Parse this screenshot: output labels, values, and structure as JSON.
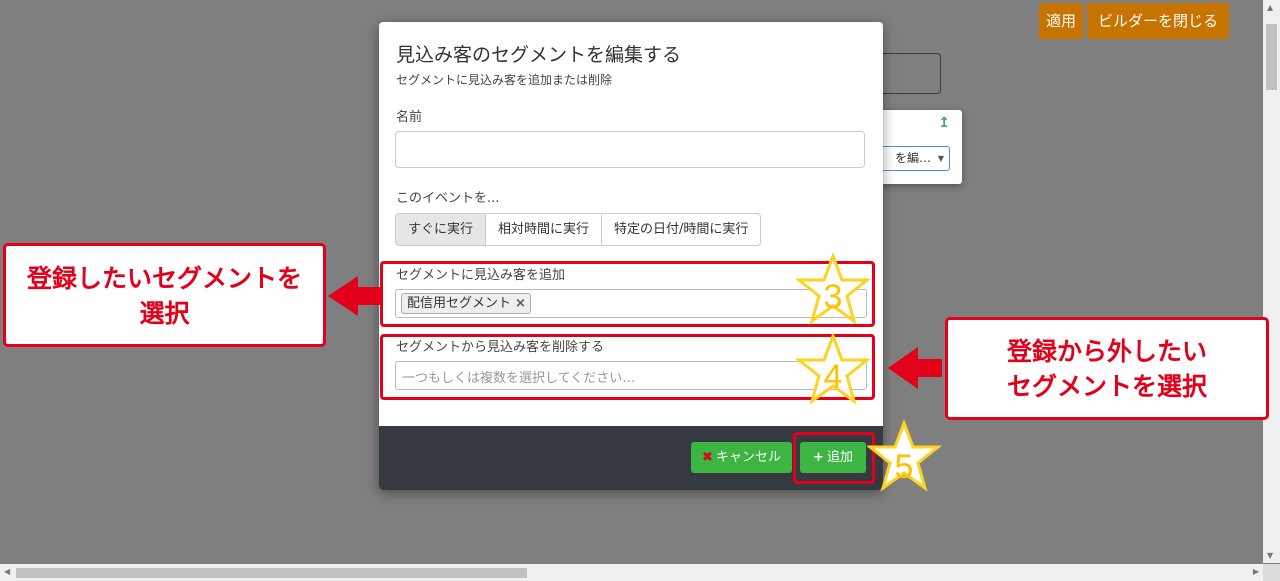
{
  "background": {
    "apply_label": "適用",
    "close_builder_label": "ビルダーを閉じる",
    "partial_select_text": "を編…"
  },
  "modal": {
    "title": "見込み客のセグメントを編集する",
    "subtitle": "セグメントに見込み客を追加または削除",
    "name_label": "名前",
    "name_value": "",
    "event_label": "このイベントを...",
    "timing_tabs": [
      "すぐに実行",
      "相対時間に実行",
      "特定の日付/時間に実行"
    ],
    "add_label": "セグメントに見込み客を追加",
    "add_selected_chip": "配信用セグメント",
    "remove_label": "セグメントから見込み客を削除する",
    "remove_placeholder": "一つもしくは複数を選択してください…",
    "cancel_label": "キャンセル",
    "add_button_label": "追加"
  },
  "annotations": {
    "step3": "3",
    "step4": "4",
    "step5": "5",
    "callout_left": [
      "登録したいセグメントを",
      "選択"
    ],
    "callout_right": [
      "登録から外したい",
      "セグメントを選択"
    ]
  },
  "colors": {
    "accent_red": "#e2001b",
    "star_fill": "#ffd21f",
    "button_green": "#3cb543",
    "orange_button": "#c77300",
    "footer_dark": "#353a40"
  }
}
